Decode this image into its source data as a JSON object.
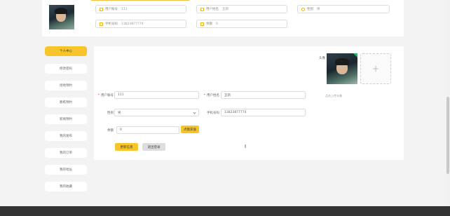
{
  "profile_summary": {
    "account_label": "用户账号",
    "account_value": "111",
    "name_label": "用户姓名",
    "name_value": "王新",
    "gender_label": "性别",
    "gender_value": "男",
    "phone_label": "手机号码",
    "phone_value": "13823877774",
    "balance_label": "余额",
    "balance_value": "0"
  },
  "sidebar": {
    "items": [
      {
        "label": "个人中心",
        "active": true
      },
      {
        "label": "修改密码"
      },
      {
        "label": "场地预约"
      },
      {
        "label": "教练预约"
      },
      {
        "label": "新闻预约"
      },
      {
        "label": "我的发布"
      },
      {
        "label": "我的订单"
      },
      {
        "label": "我的地址"
      },
      {
        "label": "我的收藏"
      }
    ]
  },
  "form": {
    "avatar_label": "头像",
    "avatar_hint": "点击上传头像",
    "upload_plus": "+",
    "account_label": "用户账号",
    "account_value": "111",
    "name_label": "用户姓名",
    "name_value": "王新",
    "gender_label": "性别",
    "gender_value": "男",
    "phone_label": "手机号码",
    "phone_value": "13823877774",
    "balance_label": "余额",
    "balance_value": "0",
    "recharge_label": "点我充值",
    "update_label": "更新信息",
    "logout_label": "退出登录"
  },
  "colors": {
    "accent": "#f7c52a",
    "required": "#e33333"
  }
}
